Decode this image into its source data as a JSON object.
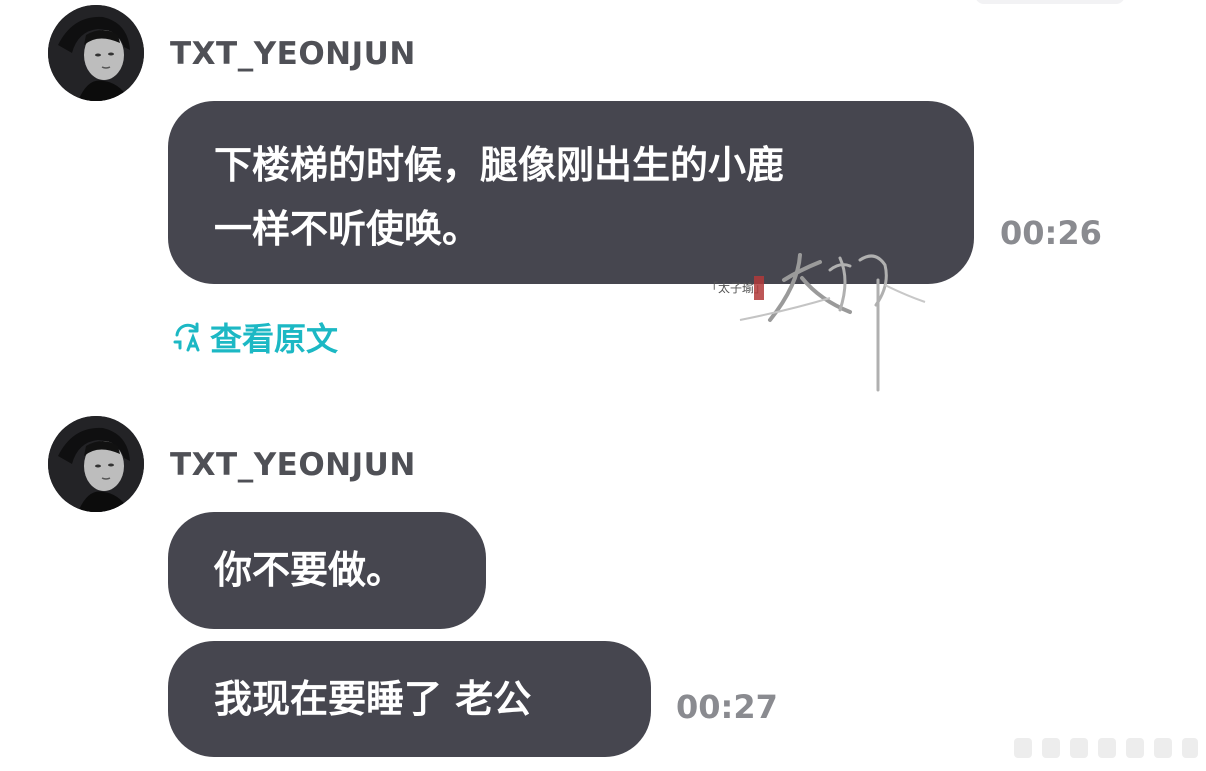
{
  "messages": [
    {
      "username": "TXT_YEONJUN",
      "lines": [
        "下楼梯的时候，腿像刚出生的小鹿",
        "一样不听使唤。"
      ],
      "time": "00:26",
      "translate_label": "查看原文"
    },
    {
      "username": "TXT_YEONJUN",
      "bubble1": "你不要做。",
      "bubble2": "我现在要睡了 老公",
      "time": "00:27"
    }
  ],
  "watermark": {
    "seal_text": "太子",
    "small_text": "「太子瑜」"
  },
  "colors": {
    "bubble": "#46464f",
    "link": "#1cb8c4",
    "username": "#4f5056",
    "timestamp": "#8a8b90"
  },
  "icons": {
    "translate": "translate-icon",
    "avatar": "avatar-photo"
  }
}
